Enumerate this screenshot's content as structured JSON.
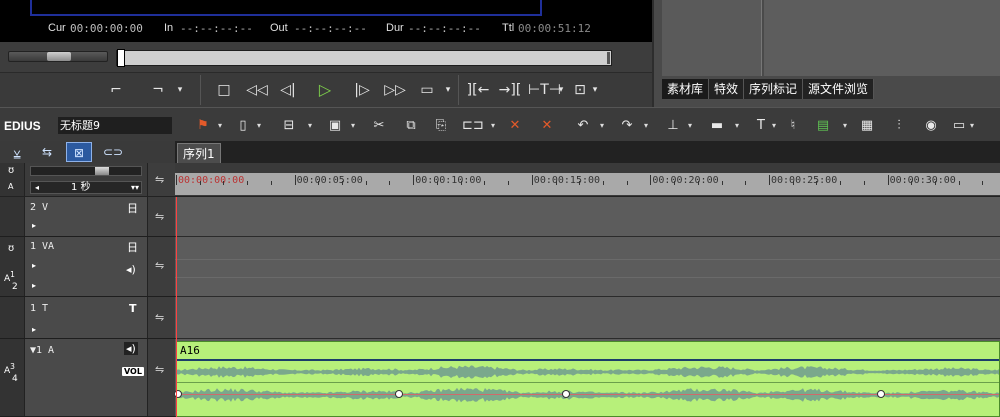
{
  "player": {
    "timecodes": [
      {
        "label": "Cur",
        "value": "00:00:00:00"
      },
      {
        "label": "In",
        "value": "--:--:--:--"
      },
      {
        "label": "Out",
        "value": "--:--:--:--"
      },
      {
        "label": "Dur",
        "value": "--:--:--:--"
      },
      {
        "label": "Ttl",
        "value": "00:00:51:12"
      }
    ],
    "scrub_position": 0.0
  },
  "bin_panel": {
    "tabs": [
      "素材库",
      "特效",
      "序列标记",
      "源文件浏览"
    ]
  },
  "app": {
    "name": "EDIUS",
    "project": "无标题9"
  },
  "timeline": {
    "sequence_tab": "序列1",
    "zoom_label": "1 秒",
    "ruler_labels": [
      "00:00:00:00",
      "00:00:05:00",
      "00:00:10:00",
      "00:00:15:00",
      "00:00:20:00",
      "00:00:25:00",
      "00:00:30:00"
    ],
    "tracks": [
      {
        "name": "2 V"
      },
      {
        "name": "1 VA"
      },
      {
        "name": "1 T",
        "icon": "T"
      },
      {
        "name": "▼1 A",
        "vol_badge": "VOL"
      }
    ],
    "track_channels": {
      "va": [
        "A",
        "1",
        "2"
      ],
      "a": [
        "A",
        "3",
        "4"
      ]
    },
    "clip": {
      "label": "A16",
      "color": "#b7f07a"
    }
  },
  "colors": {
    "play_accent": "#7fd24b",
    "active_mode": "#2c5aa0",
    "cursor": "#ff4040"
  }
}
